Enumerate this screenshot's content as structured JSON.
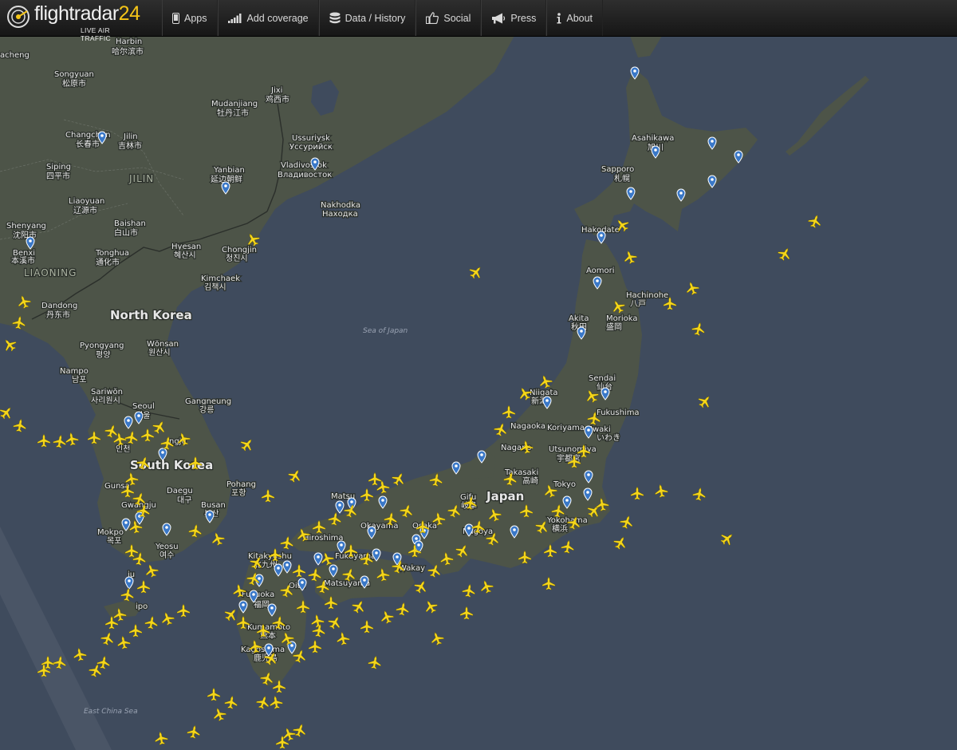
{
  "header": {
    "brand_text": "flightradar",
    "brand_number": "24",
    "tagline": "LIVE AIR TRAFFIC",
    "nav": [
      {
        "label": "Apps",
        "icon": "phone-icon"
      },
      {
        "label": "Add coverage",
        "icon": "signal-bars-icon"
      },
      {
        "label": "Data / History",
        "icon": "database-icon"
      },
      {
        "label": "Social",
        "icon": "thumbs-up-icon"
      },
      {
        "label": "Press",
        "icon": "megaphone-icon"
      },
      {
        "label": "About",
        "icon": "info-icon"
      }
    ]
  },
  "map": {
    "labels": {
      "harbin": "Harbin",
      "harbin_cjk": "哈尔滨市",
      "songyuan": "Songyuan",
      "songyuan_cjk": "松原市",
      "acheng": "acheng",
      "changchun": "Changchun",
      "changchun_cjk": "长春市",
      "jilin_city": "Jilin",
      "jilin_city_cjk": "吉林市",
      "siping": "Siping",
      "siping_cjk": "四平市",
      "jilin_region": "JILIN",
      "liaoyuan": "Liaoyuan",
      "liaoyuan_cjk": "辽源市",
      "shenyang": "Shenyang",
      "shenyang_cjk": "沈阳市",
      "benxi": "Benxi",
      "benxi_cjk": "本溪市",
      "baishan": "Baishan",
      "baishan_cjk": "白山市",
      "tonghua": "Tonghua",
      "tonghua_cjk": "通化市",
      "liaoning_region": "LIAONING",
      "yanbian": "Yanbian",
      "yanbian_cjk": "延边朝鲜",
      "mudanjiang": "Mudanjiang",
      "mudanjiang_cjk": "牡丹江市",
      "jixi": "Jixi",
      "jixi_cjk": "鸡西市",
      "ussuriysk": "Ussuriysk",
      "ussuriysk_cyr": "Уссурийск",
      "vladivostok": "Vladivostok",
      "vladivostok_cyr": "Владивосток",
      "nakhodka": "Nakhodka",
      "nakhodka_cyr": "Находка",
      "hyesan": "Hyesan",
      "hyesan_cjk": "혜산시",
      "chongjin": "Chongjin",
      "chongjin_cjk": "청진시",
      "kimchaek": "Kimchaek",
      "kimchaek_cjk": "김책시",
      "dandong": "Dandong",
      "dandong_cjk": "丹东市",
      "north_korea": "North Korea",
      "pyongyang": "Pyongyang",
      "pyongyang_cjk": "평양",
      "wonsan": "Wŏnsan",
      "wonsan_cjk": "원산시",
      "nampo": "Nampo",
      "nampo_cjk": "남포",
      "sariwon": "Sariwŏn",
      "sariwon_cjk": "사리원시",
      "seoul": "Seoul",
      "seoul_cjk": "서울",
      "incheon_cjk": "인천",
      "gangneung": "Gangneung",
      "gangneung_cjk": "강릉",
      "south_korea": "South Korea",
      "cheongju": "ngju",
      "pohang": "Pohang",
      "pohang_cjk": "포항",
      "daegu": "Daegu",
      "daegu_cjk": "대구",
      "busan": "Busan",
      "busan_cjk": "부산",
      "gunsan": "Gunsa",
      "gwangju": "Gwangju",
      "mokpo": "Mokpo",
      "mokpo_cjk": "목포",
      "yeosu": "Yeosu",
      "yeosu_cjk": "여수",
      "jeju": "ju",
      "seogwipo": "ipo",
      "sea_of_japan": "Sea of Japan",
      "east_china_sea": "East China Sea",
      "asahikawa": "Asahikawa",
      "asahikawa_cjk": "旭川",
      "sapporo": "Sapporo",
      "sapporo_cjk": "札幌",
      "hakodate": "Hakodate",
      "aomori": "Aomori",
      "hachinohe": "Hachinohe",
      "hachinohe_cjk": "八戸",
      "akita": "Akita",
      "akita_cjk": "秋田",
      "morioka": "Morioka",
      "morioka_cjk": "盛岡",
      "sendai": "Sendai",
      "sendai_cjk": "仙台",
      "niigata": "Niigata",
      "niigata_cjk": "新潟",
      "fukushima": "Fukushima",
      "nagaoka": "Nagaoka",
      "koriyama": "Koriyama",
      "iwaki": "Iwaki",
      "iwaki_cjk": "いわき",
      "nagano": "Nagano",
      "utsunomiya": "Utsunomiya",
      "utsunomiya_cjk": "宇都宮",
      "takasaki": "Takasaki",
      "takasaki_cjk": "高崎",
      "tokyo": "Tokyo",
      "japan": "Japan",
      "yokohama": "Yokohama",
      "yokohama_cjk": "横浜",
      "gifu": "Gifu",
      "gifu_cjk": "岐阜",
      "nagoya": "Nagoya",
      "osaka": "Osaka",
      "okayama": "Okayama",
      "matsue": "Matsu",
      "hiroshima": "Hiroshima",
      "fukuyama": "Fukuyama",
      "kitakyushu": "Kitakyushu",
      "kitakyushu_cjk": "北九州",
      "wakayama": "Wakay",
      "matsuyama": "Matsuyama",
      "oita": "Oita",
      "fukuoka": "Fukuoka",
      "fukuoka_cjk": "福岡",
      "kumamoto": "Kumamoto",
      "kumamoto_cjk": "熊本",
      "kagoshima": "Kagoshima",
      "kagoshima_cjk": "鹿児島"
    },
    "aircraft_color": "#f5d61a",
    "airport_marker_color": "#3a78c8",
    "land_color": "#4d5448",
    "sea_color": "#3f4b5d"
  }
}
